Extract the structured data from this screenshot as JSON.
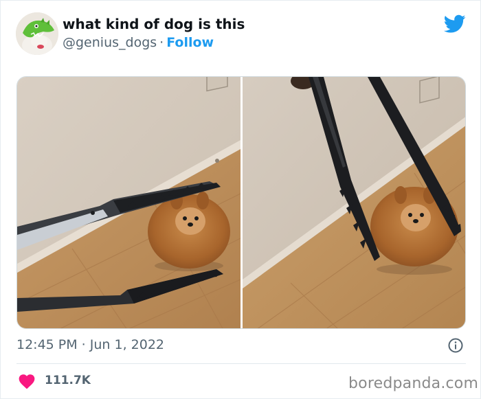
{
  "tweet": {
    "display_name": "what kind of dog is this",
    "handle": "@genius_dogs",
    "separator": "·",
    "follow_label": "Follow",
    "timestamp": "12:45 PM · Jun 1, 2022",
    "likes": "111.7K"
  },
  "icons": {
    "brand": "twitter-bird-icon",
    "info": "info-icon",
    "like": "heart-icon"
  },
  "colors": {
    "accent": "#1d9bf0",
    "like": "#f91880",
    "secondary_text": "#536471"
  },
  "watermark": "boredpanda.com"
}
